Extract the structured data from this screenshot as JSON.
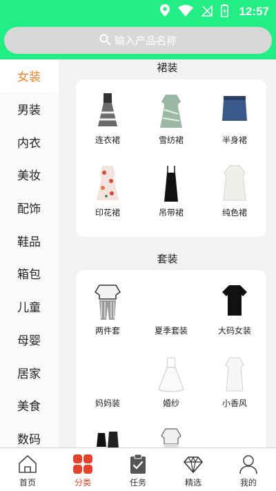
{
  "status": {
    "time": "12:57"
  },
  "search": {
    "placeholder": "输入产品名称"
  },
  "sidebar": {
    "items": [
      "女装",
      "男装",
      "内衣",
      "美妆",
      "配饰",
      "鞋品",
      "箱包",
      "儿童",
      "母婴",
      "居家",
      "美食",
      "数码"
    ],
    "active": "女装"
  },
  "sections": [
    {
      "title": "裙装",
      "items": [
        "连衣裙",
        "雪纺裙",
        "半身裙",
        "印花裙",
        "吊带裙",
        "纯色裙"
      ]
    },
    {
      "title": "套装",
      "items": [
        "两件套",
        "夏季套装",
        "大码女装",
        "妈妈装",
        "婚纱",
        "小香风"
      ]
    }
  ],
  "tabbar": {
    "items": [
      "首页",
      "分类",
      "任务",
      "精选",
      "我的"
    ],
    "active": "分类"
  },
  "colors": {
    "header": "#22ee83",
    "active_side": "#f0812a",
    "active_tab": "#e8412c"
  },
  "icons": [
    "location-icon",
    "wifi-icon",
    "no-sim-icon",
    "battery-icon",
    "search-icon",
    "home-icon",
    "category-icon",
    "task-icon",
    "diamond-icon",
    "user-icon"
  ]
}
